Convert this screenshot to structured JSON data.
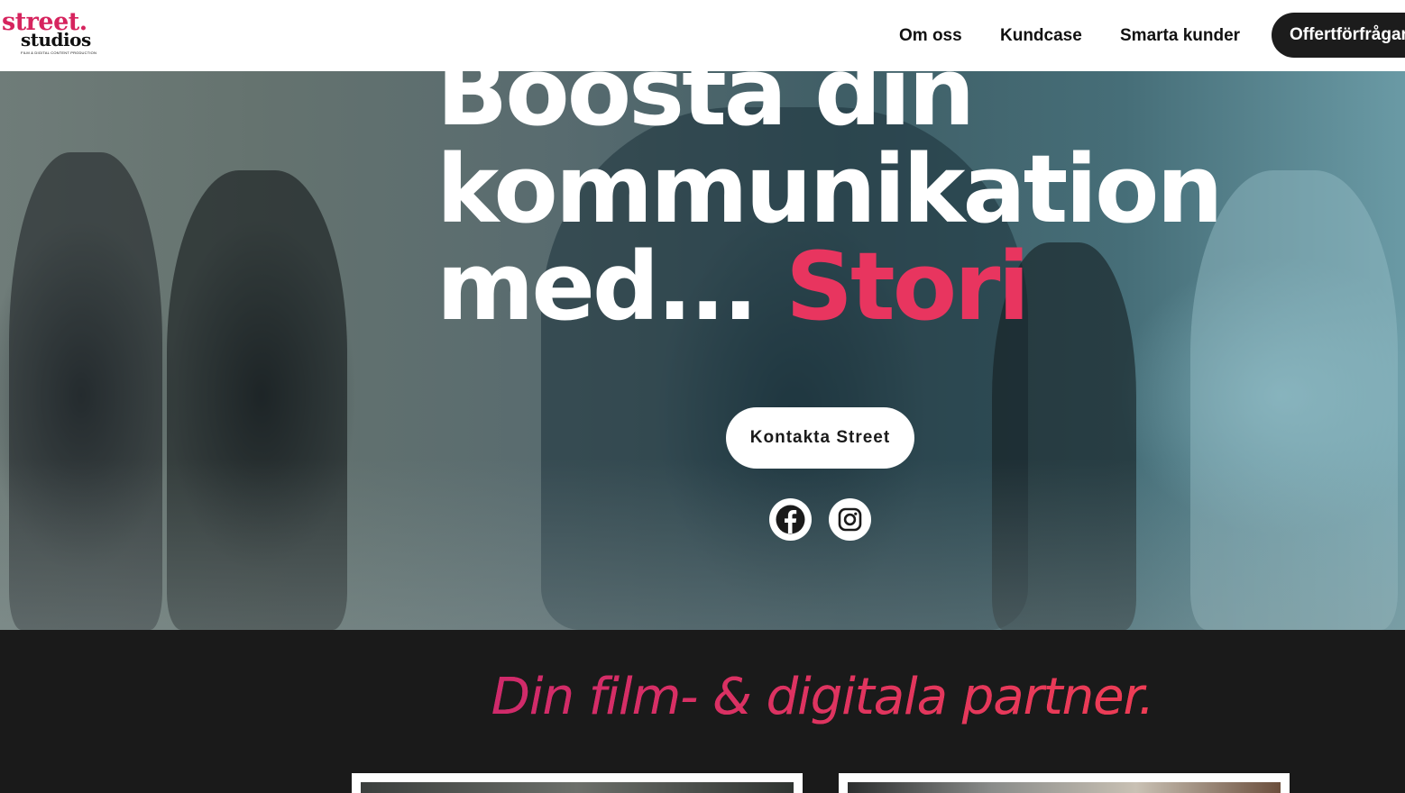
{
  "header": {
    "logo": {
      "line1": "street.",
      "line2": "studios",
      "tagline": "FILM & DIGITAL CONTENT PRODUCTION"
    },
    "nav": [
      {
        "label": "Om oss"
      },
      {
        "label": "Kundcase"
      },
      {
        "label": "Smarta kunder"
      }
    ],
    "cta_label": "Offertförfrågan"
  },
  "hero": {
    "headline_line1": "Boosta din",
    "headline_line2": "kommunikation",
    "headline_line3": "med...",
    "headline_accent": "Stori",
    "cta_label": "Kontakta Street",
    "social": [
      {
        "icon": "facebook-icon"
      },
      {
        "icon": "instagram-icon"
      }
    ]
  },
  "section": {
    "tagline": "Din film- & digitala partner."
  },
  "colors": {
    "accent": "#e8355f",
    "dark": "#1a1a1a",
    "white": "#ffffff"
  }
}
